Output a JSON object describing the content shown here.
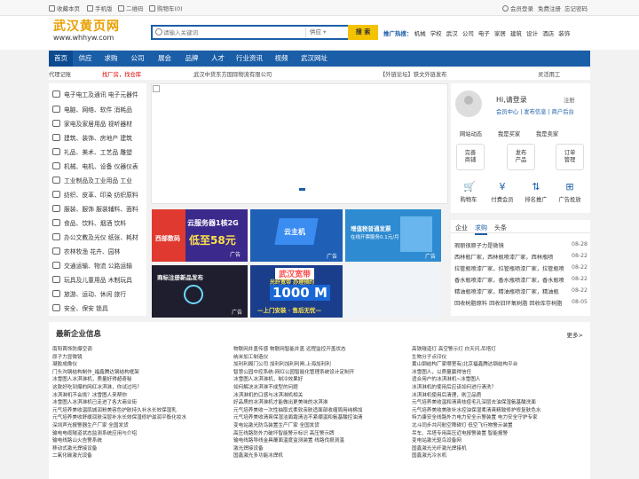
{
  "topbar": {
    "left": [
      "收藏本页",
      "手机版",
      "二维码",
      "购物车(0)"
    ],
    "right": [
      "会员登录",
      "免费注册",
      "忘记密码"
    ]
  },
  "logo": {
    "cn": "武汉黄页网",
    "en": "www.whhyw.com"
  },
  "search": {
    "placeholder": "请输入关键词",
    "select": "供应",
    "button": "搜 索"
  },
  "hot": {
    "label": "推广热搜：",
    "items": [
      "机械",
      "学校",
      "武汉",
      "公司",
      "电子",
      "家居",
      "建筑",
      "设计",
      "酒店",
      "装饰"
    ]
  },
  "nav": [
    "首页",
    "供应",
    "求购",
    "公司",
    "展会",
    "品牌",
    "人才",
    "行业资讯",
    "视频",
    "武汉网址"
  ],
  "strip": [
    "代理记账",
    "找厂房，找仓库",
    "武汉中货东方国际物流有限公司",
    "【外链论坛】铁文外链发布",
    "灵活用工"
  ],
  "categories": [
    "电子电工及通讯 电子元器件",
    "电脑、网络、软件 消耗品",
    "家电及家居用品 视听器材",
    "建筑、装饰、房地产 建筑",
    "礼品、美术、工艺品 雕塑",
    "机械、电机、设备 仪器仪表",
    "工业制品及工业用品 工业",
    "纺织、皮革、印染 纺织原料",
    "服装、服饰 服装辅料、面料",
    "食品、饮料、烟酒 饮料",
    "办公文教及光仪 纸张、耗材",
    "农林牧渔 花卉、园林",
    "交通运输、物流 公路运输",
    "玩具及儿童用品 木制玩具",
    "旅游、运动、休闲 旅行",
    "安全、保安 锁具"
  ],
  "ads": {
    "a1": {
      "t1": "西部数码",
      "t2": "云服务器1核2G",
      "t3": "低至58元",
      "t4": "广告"
    },
    "a2": {
      "t1": "云主机",
      "t2": "广告"
    },
    "a3": {
      "t1": "增值税普通发票",
      "t2": "在线开票服务0.1元/月",
      "t3": "广告"
    },
    "a4": {
      "t1": "商标注册新品发布",
      "t2": "广告"
    },
    "a5": {
      "t1": "武汉宽带",
      "t2": "光纤宽带 办理预约",
      "t3": "1000 M",
      "t4": "—上门安装 · 售后无忧—"
    }
  },
  "user": {
    "greeting": "Hi,请登录",
    "register": "注册",
    "links": "会员中心 | 发布信息 | 商户后台",
    "tabs": [
      "网站动态",
      "我是买家",
      "我是卖家"
    ],
    "boxes": [
      [
        "完善",
        "商铺"
      ],
      [
        "发布",
        "产品"
      ],
      [
        "订单",
        "管理"
      ]
    ],
    "icons": [
      "购物车",
      "付费会员",
      "排名推广",
      "广告投放"
    ]
  },
  "news": {
    "tabs": [
      "企业",
      "求购",
      "头条"
    ],
    "rows": [
      {
        "t": "瑕丽很原子力是微镜",
        "d": "08-28"
      },
      {
        "t": "西林瓶厂家，西林瓶喷漆厂家，西林瓶喷",
        "d": "08-22"
      },
      {
        "t": "拉管瓶喷漆厂家，拉管瓶喷漆厂家，拉管瓶喷",
        "d": "08-22"
      },
      {
        "t": "香水瓶喷漆厂家，香水瓶喷漆厂家，香水瓶喷",
        "d": "08-22"
      },
      {
        "t": "精油瓶喷漆厂家，精油瓶喷漆厂家，精油瓶",
        "d": "08-22"
      },
      {
        "t": "回收树脂原料 回收旧环氧树脂 回收库存树脂",
        "d": "08-05"
      }
    ]
  },
  "latest": {
    "title": "最新企业信息",
    "more": "更多>",
    "col1": [
      "南阳首饰防爆空调",
      "原子力显微镜",
      "凝胶成像仪",
      "门头沟钢结构制作_福鑫腾达钢结构框架",
      "冰雪图人冰淇淋机，质量好得超奇秘",
      "这款好吃到爆的网红冰淇淋，你试过吗？",
      "冰淇淋机不会挑？冰雪图人来帮你",
      "冰雪图人冰淇淋机已走进了各大商业街",
      "元气培养美收温肌城润粉美容色护肤持久补水长效保湿乳",
      "元气培养美收舒缓润肤深层补水长效保湿修护滋润平衡化妆水",
      "深圳声光报警器生产厂家 全国发货",
      "输电电缆隧道状态监测系统应用与介绍",
      "输电线路山火告警系统",
      "移动式激光焊接设备",
      "二氧化碳激光设备"
    ],
    "col2": [
      "物联网井盖传感 物联网智能井盖 远程监控开盖状态",
      "纳米加工制造仪",
      "加利利阁门公司 加利利加利利闸,上海加利利",
      "智慧公园中控系统-网红公园智能化管理系统设计定制开",
      "冰雪图人冰淇淋机，制冷效果好",
      "如何解决冰淇淋不成型的问题",
      "冰淇淋机的口感与冰淇淋机相关",
      "好品质的冰淇淋机才能做出更美味的冰淇淋",
      "元气培养美收一次性抽取式柔软亲肤适面部收缩周用纯棉加",
      "元气培养美收清爽保湿洁面霜清洁不紧绷温和氨基酸控油清",
      "变电站激光防鸟装置生产厂家 全国发货",
      "高压线路防外力破坏智能警示标识 高压警示牌",
      "输电线路导线金具覆面温度监测装置 线路伐损测温",
      "激光焊接设备",
      "国鑫激光多功能冰焊机"
    ],
    "col3": [
      "高铁隧道灯 高空警示灯 白天闪,吊塔灯",
      "生物分子点印仪",
      "黄山钢结构厂家哪里有|北京福鑫腾达钢结构平台",
      "冰雪图人，以质量赢得信任",
      "适合用户的冰淇淋机~冰雪图人",
      "冰淇淋机的使用后应该如何进行清洗？",
      "冰淇淋机使用后清理，刷卫品质",
      "元气培养美收温和清爽祛痘毛孔深层去油保湿氨基酸洗面",
      "元气培养美收美肤补水控油保湿柔清爽精致修护修复肤色水",
      "特力康安全线路外力电力安全示警装置 电力安全守护专家",
      "北斗同步共闪航空障碍灯 低空飞行物警示装置",
      "吊车、吊塔专用高压近电报警装置 智能报警",
      "变电站激光驱鸟设备网",
      "国鑫激光光纤激光焊接机",
      "国鑫激光冷水机"
    ]
  }
}
